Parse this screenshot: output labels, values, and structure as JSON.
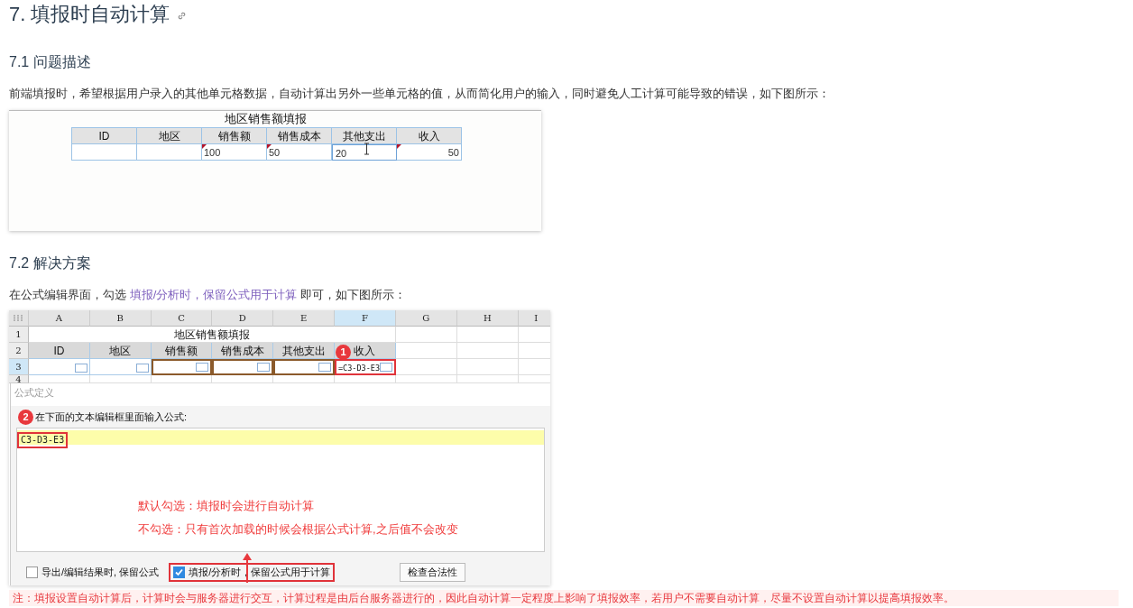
{
  "title": "7. 填报时自动计算",
  "sections": [
    {
      "heading": "7.1 问题描述",
      "paragraph": {
        "before": "前端填报时，希望根据用户录入的其他单元格数据，自动计算出另外一些单元格的值，从而简化用户的输入，同时避免人工计算可能导致的错误，如下图所示："
      },
      "form": {
        "title": "地区销售额填报",
        "headers": [
          "ID",
          "地区",
          "销售额",
          "销售成本",
          "其他支出",
          "收入"
        ],
        "cells": [
          {
            "kind": "input",
            "marked": false,
            "editing": false
          },
          {
            "kind": "input",
            "marked": false,
            "editing": false
          },
          {
            "kind": "input",
            "value": "100",
            "marked": true,
            "editing": false
          },
          {
            "kind": "input",
            "value": "50",
            "marked": true,
            "editing": false
          },
          {
            "kind": "input",
            "value": "20",
            "marked": false,
            "editing": true
          },
          {
            "kind": "computed",
            "value": "50",
            "marked": true,
            "editing": false
          }
        ]
      }
    },
    {
      "heading": "7.2 解决方案",
      "paragraph": {
        "before": "在公式编辑界面，勾选 ",
        "link": "填报/分析时，保留公式用于计算",
        "after": " 即可，如下图所示："
      },
      "sheet": {
        "columns": [
          {
            "label": "A",
            "selected": false
          },
          {
            "label": "B",
            "selected": false
          },
          {
            "label": "C",
            "selected": false
          },
          {
            "label": "D",
            "selected": false
          },
          {
            "label": "E",
            "selected": false
          },
          {
            "label": "F",
            "selected": true
          },
          {
            "label": "G",
            "selected": false
          },
          {
            "label": "H",
            "selected": false
          },
          {
            "label": "I",
            "selected": false
          }
        ],
        "rows": [
          {
            "label": "1",
            "selected": false
          },
          {
            "label": "2",
            "selected": false
          },
          {
            "label": "3",
            "selected": true
          },
          {
            "label": "4",
            "selected": false
          }
        ],
        "title": "地区销售额填报",
        "headers": [
          "ID",
          "地区",
          "销售额",
          "销售成本",
          "其他支出",
          "收入"
        ],
        "cells": [
          {
            "highlighted": false,
            "selected": false
          },
          {
            "highlighted": false,
            "selected": false
          },
          {
            "highlighted": true,
            "selected": false
          },
          {
            "highlighted": true,
            "selected": false
          },
          {
            "highlighted": true,
            "selected": false
          },
          {
            "value": "=C3-D3-E3",
            "highlighted": false,
            "selected": true
          }
        ],
        "badge": "1"
      },
      "dialog": {
        "title": "公式定义",
        "badge": "2",
        "label": "在下面的文本编辑框里面输入公式:",
        "formula": "C3-D3-E3",
        "annotations": [
          "默认勾选：填报时会进行自动计算",
          "不勾选：只有首次加载的时候会根据公式计算,之后值不会改变"
        ],
        "options": [
          {
            "label": "导出/编辑结果时, 保留公式",
            "checked": false,
            "highlighted": false
          },
          {
            "label": "填报/分析时，保留公式用于计算",
            "checked": true,
            "highlighted": true
          }
        ],
        "button": "检查合法性"
      }
    }
  ],
  "note": "注：填报设置自动计算后，计算时会与服务器进行交互，计算过程是由后台服务器进行的，因此自动计算一定程度上影响了填报效率，若用户不需要自动计算，尽量不设置自动计算以提高填报效率。"
}
